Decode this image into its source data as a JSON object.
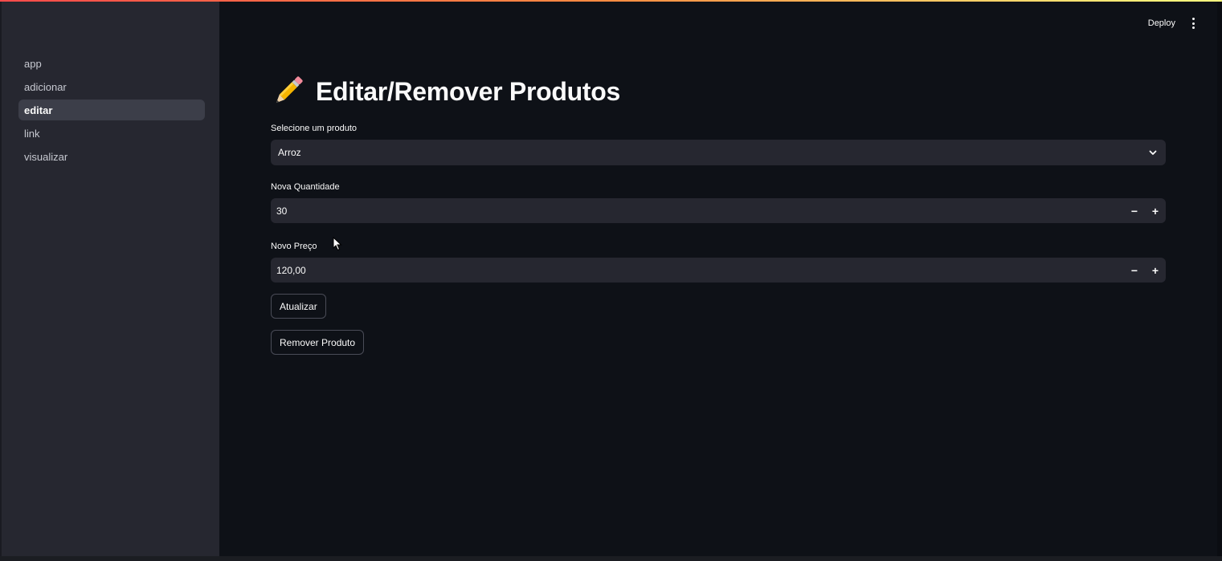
{
  "sidebar": {
    "items": [
      {
        "label": "app"
      },
      {
        "label": "adicionar"
      },
      {
        "label": "editar",
        "active": true
      },
      {
        "label": "link"
      },
      {
        "label": "visualizar"
      }
    ]
  },
  "header": {
    "deploy_label": "Deploy",
    "menu_icon": "kebab-menu-icon"
  },
  "main": {
    "title_icon": "pencil-emoji",
    "title": "Editar/Remover Produtos",
    "product_select": {
      "label": "Selecione um produto",
      "value": "Arroz"
    },
    "quantity": {
      "label": "Nova Quantidade",
      "value": "30"
    },
    "price": {
      "label": "Novo Preço",
      "value": "120,00"
    },
    "update_button": "Atualizar",
    "remove_button": "Remover Produto"
  },
  "colors": {
    "background": "#0e1117",
    "sidebar": "#262730",
    "input": "#262730",
    "active_nav": "#3c3e49",
    "accent": "#ff4b4b"
  }
}
